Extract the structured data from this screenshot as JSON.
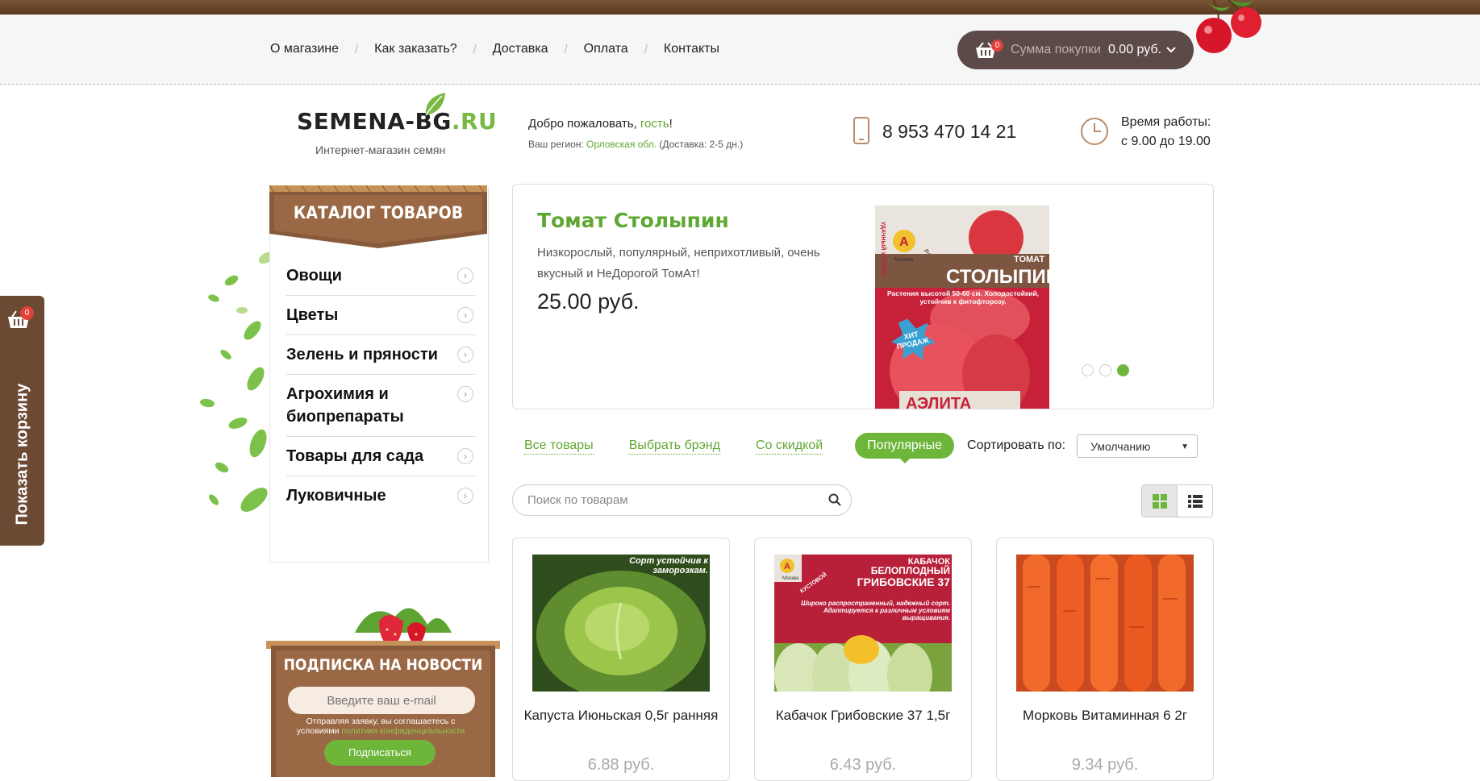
{
  "nav": {
    "items": [
      "О магазине",
      "Как заказать?",
      "Доставка",
      "Оплата",
      "Контакты"
    ],
    "separator": "/"
  },
  "cart": {
    "count": "0",
    "sum_label": "Сумма покупки",
    "sum_value": "0.00 руб."
  },
  "header": {
    "logo_main": "SEMENA-BG",
    "logo_suffix": ".RU",
    "tagline": "Интернет-магазин семян",
    "welcome_prefix": "Добро пожаловать, ",
    "welcome_user": "гость",
    "welcome_suffix": "!",
    "region_prefix": "Ваш регион: ",
    "region_value": "Орловская обл.",
    "region_suffix": " (Доставка: 2-5 дн.)",
    "phone": "8 953 470 14 21",
    "hours_label": "Время работы:",
    "hours_value": "с 9.00 до 19.00"
  },
  "catalog": {
    "title": "КАТАЛОГ ТОВАРОВ",
    "items": [
      "Овощи",
      "Цветы",
      "Зелень и пряности",
      "Агрохимия и биопрепараты",
      "Товары для сада",
      "Луковичные"
    ]
  },
  "side_cart": {
    "label": "Показать корзину",
    "count": "0"
  },
  "subscribe": {
    "title": "ПОДПИСКА НА НОВОСТИ",
    "placeholder": "Введите ваш e-mail",
    "note_prefix": "Отправляя заявку, вы соглашаетесь с условиями ",
    "note_link": "политики конфиденциальности",
    "button": "Подписаться"
  },
  "slider": {
    "name": "Томат Столыпин",
    "description": "Низкорослый, популярный, неприхотливый, очень вкусный и НеДорогой ТомАт!",
    "price": "25.00 руб.",
    "pack_brand": "Москва",
    "pack_category": "ТОМАТ",
    "pack_name": "СТОЛЫПИН",
    "pack_note": "Растения высотой 50-60 см. Холодостойкий, устойчив к фитофторозу.",
    "pack_badge": "ХИТ ПРОДАЖ",
    "pack_side": "РАННЕСПЕЛЫЙ",
    "pack_top": "УДАЧНЫЙ УРОЖАЙ",
    "pack_maker": "АЭЛИТА",
    "active_slide": 3,
    "total_slides": 3
  },
  "filters": {
    "all": "Все товары",
    "brand": "Выбрать брэнд",
    "discount": "Со скидкой",
    "popular": "Популярные",
    "sort_label": "Сортировать по:",
    "sort_value": "Умолчанию"
  },
  "search": {
    "placeholder": "Поиск по товарам"
  },
  "products": [
    {
      "name": "Капуста Июньская 0,5г ранняя",
      "price": "6.88 руб.",
      "overlay": "Сорт устойчив к заморозкам."
    },
    {
      "name": "Кабачок Грибовские 37 1,5г",
      "price": "6.43 руб.",
      "overlay_title1": "КАБАЧОК",
      "overlay_title2": "БЕЛОПЛОДНЫЙ",
      "overlay_title3": "ГРИБОВСКИЕ 37",
      "overlay_side": "КУСТОВОЙ",
      "overlay_brand": "Москва",
      "overlay_text": "Широко распространенный, надежный сорт. Адаптируется к различным условиям выращивания."
    },
    {
      "name": "Морковь Витаминная 6 2г",
      "price": "9.34 руб."
    }
  ],
  "colors": {
    "brand_green": "#6db63a",
    "wood_brown": "#6c4933",
    "cart_pill": "#5b4a47",
    "badge_red": "#e0423a"
  }
}
